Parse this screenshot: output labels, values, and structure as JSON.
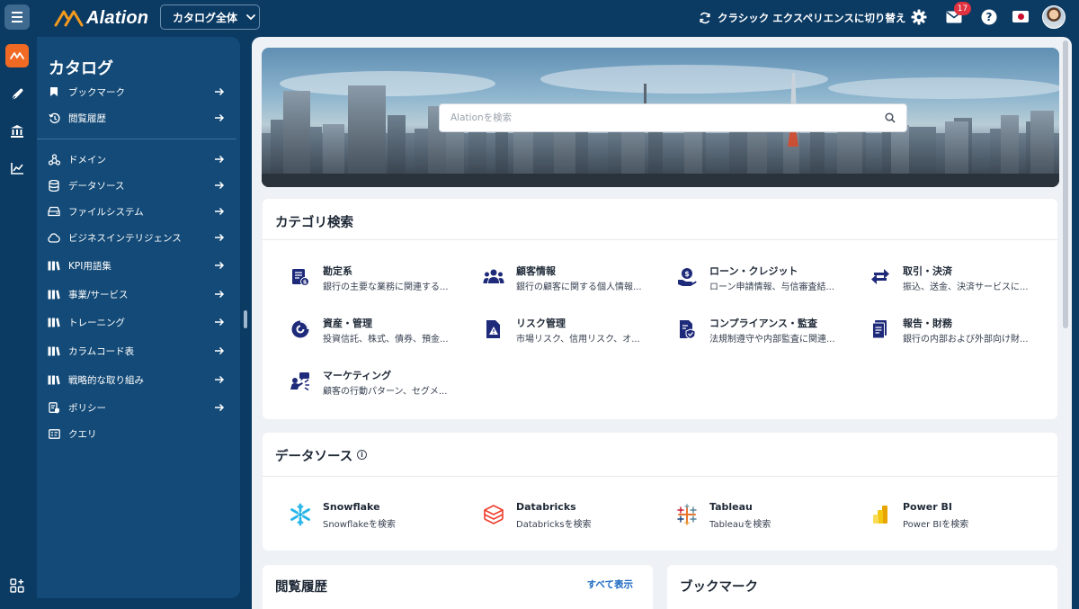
{
  "app": {
    "name": "Alation",
    "scope_label": "カタログ全体",
    "classic_label": "クラシック エクスペリエンスに切り替え",
    "notification_count": "17",
    "accent": "#f16a24",
    "nav_bg": "#0b3a63",
    "icons": [
      "menu-icon",
      "refresh-icon",
      "settings-icon",
      "mail-icon",
      "help-icon",
      "flag-japan-icon",
      "avatar"
    ]
  },
  "rail": {
    "items": [
      "catalog-icon",
      "compose-icon",
      "library-icon",
      "analytics-icon",
      "apps-add-icon"
    ]
  },
  "sidebar": {
    "title": "カタログ",
    "top_items": [
      {
        "label": "ブックマーク",
        "icon": "bookmark-icon"
      },
      {
        "label": "閲覧履歴",
        "icon": "history-icon"
      }
    ],
    "items": [
      {
        "label": "ドメイン",
        "icon": "domain-icon"
      },
      {
        "label": "データソース",
        "icon": "database-icon"
      },
      {
        "label": "ファイルシステム",
        "icon": "filesystem-icon"
      },
      {
        "label": "ビジネスインテリジェンス",
        "icon": "cloud-icon"
      },
      {
        "label": "KPI用語集",
        "icon": "glossary-icon"
      },
      {
        "label": "事業/サービス",
        "icon": "glossary-icon"
      },
      {
        "label": "トレーニング",
        "icon": "glossary-icon"
      },
      {
        "label": "カラムコード表",
        "icon": "glossary-icon"
      },
      {
        "label": "戦略的な取り組み",
        "icon": "glossary-icon"
      },
      {
        "label": "ポリシー",
        "icon": "policy-icon"
      },
      {
        "label": "クエリ",
        "icon": "query-icon"
      }
    ]
  },
  "hero": {
    "search_placeholder": "Alationを検索"
  },
  "categories": {
    "title": "カテゴリ検索",
    "items": [
      {
        "title": "勘定系",
        "desc": "銀行の主要な業務に関連する...",
        "icon": "ledger-icon"
      },
      {
        "title": "顧客情報",
        "desc": "銀行の顧客に関する個人情報...",
        "icon": "customers-icon"
      },
      {
        "title": "ローン・クレジット",
        "desc": "ローン申請情報、与信審査結...",
        "icon": "loan-icon"
      },
      {
        "title": "取引・決済",
        "desc": "振込、送金、決済サービスに...",
        "icon": "transfer-icon"
      },
      {
        "title": "資産・管理",
        "desc": "投資信託、株式、債券、預金...",
        "icon": "asset-icon"
      },
      {
        "title": "リスク管理",
        "desc": "市場リスク、信用リスク、オ...",
        "icon": "risk-icon"
      },
      {
        "title": "コンプライアンス・監査",
        "desc": "法規制遵守や内部監査に関連...",
        "icon": "compliance-icon"
      },
      {
        "title": "報告・財務",
        "desc": "銀行の内部および外部向け財...",
        "icon": "report-icon"
      },
      {
        "title": "マーケティング",
        "desc": "顧客の行動パターン、セグメ...",
        "icon": "marketing-icon"
      }
    ]
  },
  "datasources": {
    "title": "データソース",
    "items": [
      {
        "title": "Snowflake",
        "desc": "Snowflakeを検索",
        "icon": "snowflake-icon"
      },
      {
        "title": "Databricks",
        "desc": "Databricksを検索",
        "icon": "databricks-icon"
      },
      {
        "title": "Tableau",
        "desc": "Tableauを検索",
        "icon": "tableau-icon"
      },
      {
        "title": "Power BI",
        "desc": "Power BIを検索",
        "icon": "powerbi-icon"
      }
    ]
  },
  "history": {
    "title": "閲覧履歴",
    "show_all": "すべて表示"
  },
  "bookmarks": {
    "title": "ブックマーク"
  }
}
